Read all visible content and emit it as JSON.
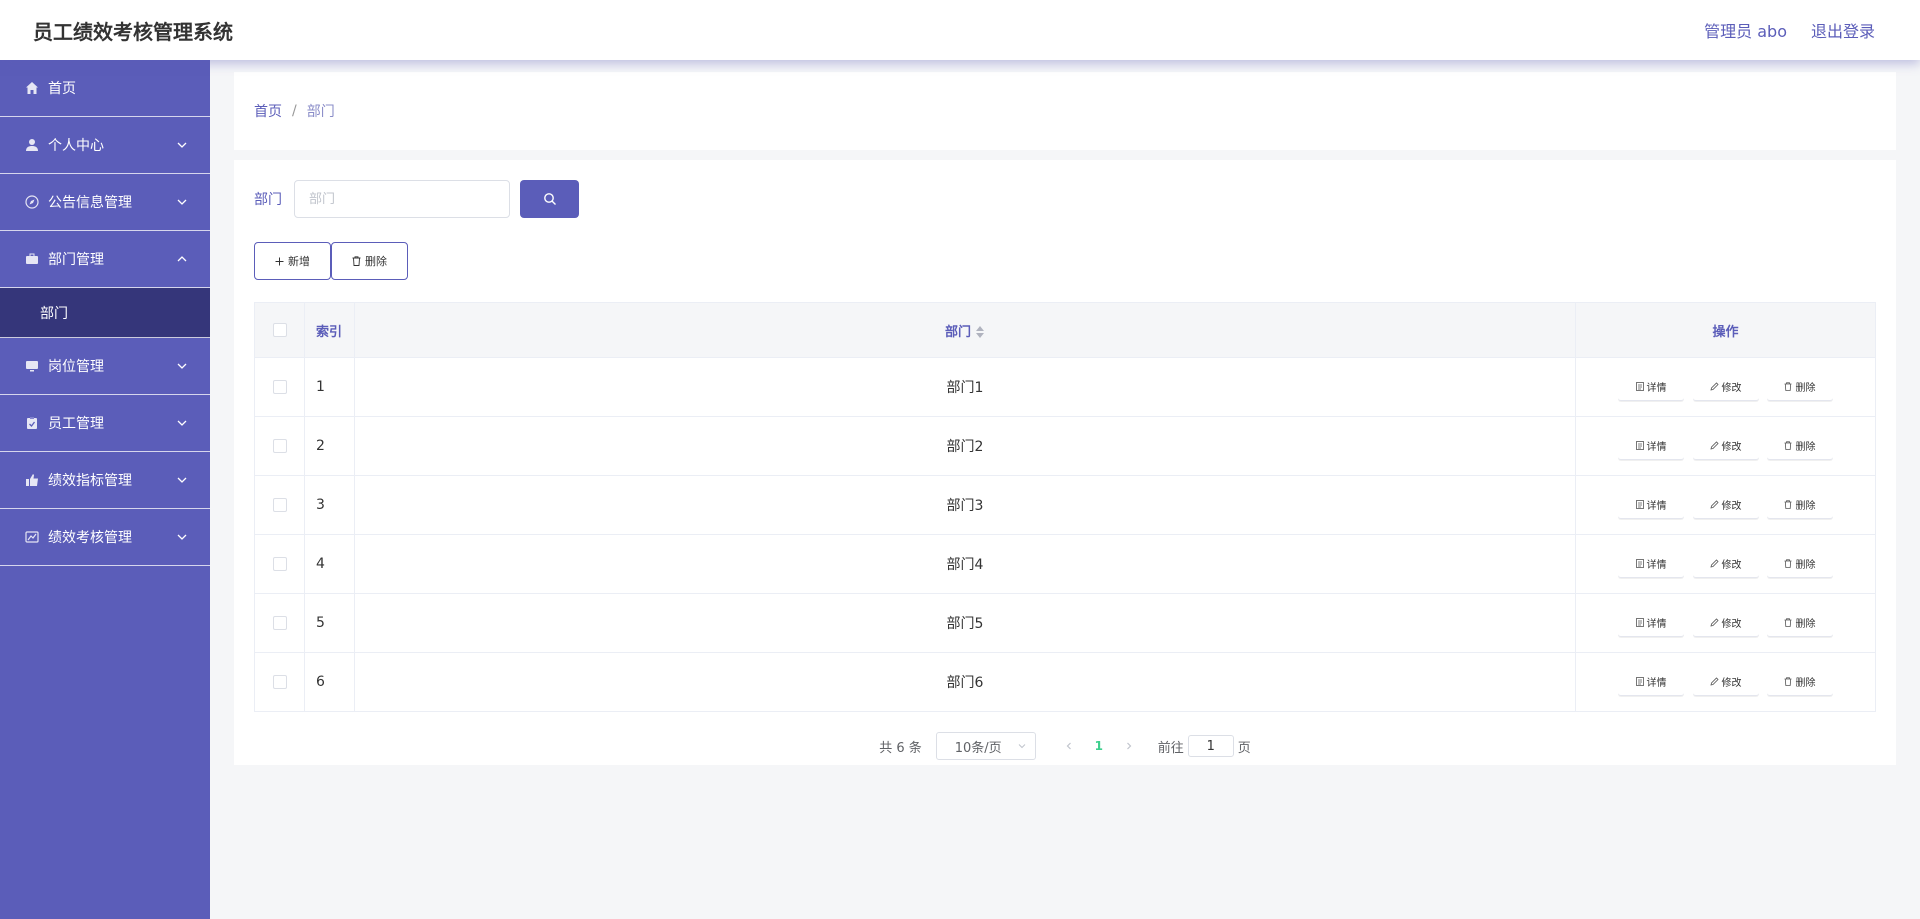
{
  "header": {
    "title": "员工绩效考核管理系统",
    "user_label": "管理员 abo",
    "logout_label": "退出登录"
  },
  "sidebar": {
    "items": [
      {
        "label": "首页",
        "icon": "home-icon",
        "has_chevron": false
      },
      {
        "label": "个人中心",
        "icon": "user-icon",
        "has_chevron": true
      },
      {
        "label": "公告信息管理",
        "icon": "compass-icon",
        "has_chevron": true
      },
      {
        "label": "部门管理",
        "icon": "briefcase-icon",
        "has_chevron": true,
        "expanded": true
      },
      {
        "label": "岗位管理",
        "icon": "monitor-icon",
        "has_chevron": true
      },
      {
        "label": "员工管理",
        "icon": "clipboard-icon",
        "has_chevron": true
      },
      {
        "label": "绩效指标管理",
        "icon": "thumb-icon",
        "has_chevron": true
      },
      {
        "label": "绩效考核管理",
        "icon": "chart-icon",
        "has_chevron": true
      }
    ],
    "sub_item": "部门"
  },
  "breadcrumb": {
    "home": "首页",
    "separator": "/",
    "current": "部门"
  },
  "search": {
    "label": "部门",
    "placeholder": "部门",
    "value": ""
  },
  "actions": {
    "add_label": "新增",
    "delete_label": "删除"
  },
  "table": {
    "columns": {
      "index": "索引",
      "dept": "部门",
      "ops": "操作"
    },
    "rows": [
      {
        "index": "1",
        "dept": "部门1"
      },
      {
        "index": "2",
        "dept": "部门2"
      },
      {
        "index": "3",
        "dept": "部门3"
      },
      {
        "index": "4",
        "dept": "部门4"
      },
      {
        "index": "5",
        "dept": "部门5"
      },
      {
        "index": "6",
        "dept": "部门6"
      }
    ],
    "row_actions": {
      "detail": "详情",
      "edit": "修改",
      "delete": "删除"
    }
  },
  "pagination": {
    "total_text": "共 6 条",
    "page_size": "10条/页",
    "current_page": "1",
    "goto_label": "前往",
    "goto_value": "1",
    "page_suffix": "页"
  },
  "colors": {
    "accent": "#5b5db9",
    "sidebar_active": "#35367a",
    "page_active": "#3ecf8e"
  }
}
